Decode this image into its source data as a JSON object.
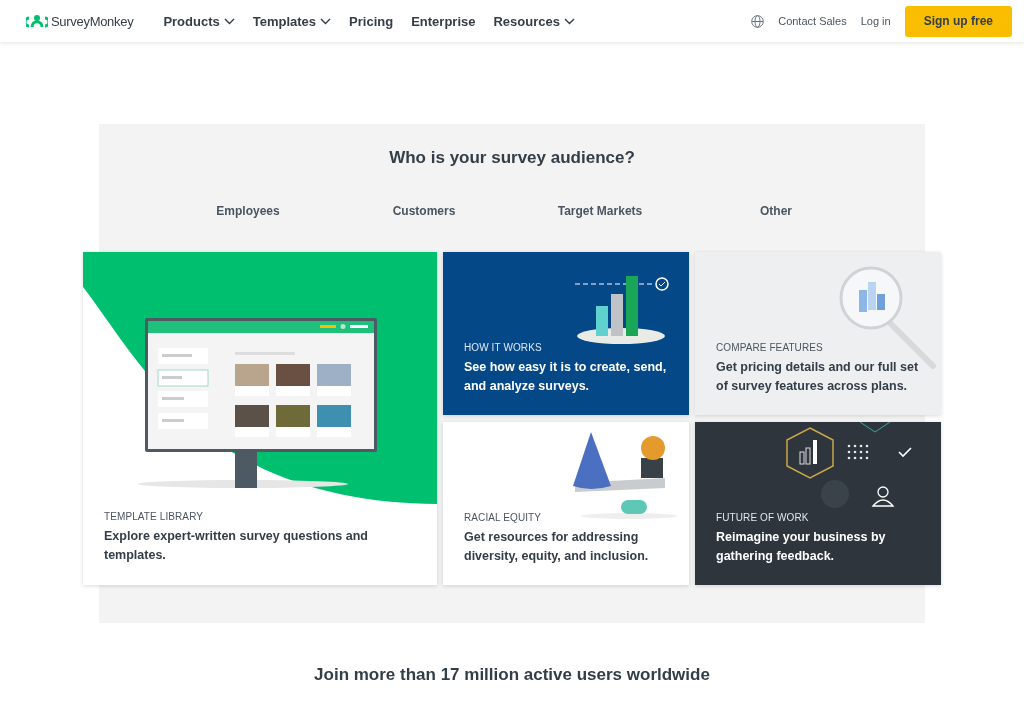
{
  "header": {
    "logo": "SurveyMonkey",
    "nav": [
      {
        "label": "Products",
        "dropdown": true
      },
      {
        "label": "Templates",
        "dropdown": true
      },
      {
        "label": "Pricing",
        "dropdown": false
      },
      {
        "label": "Enterprise",
        "dropdown": false
      },
      {
        "label": "Resources",
        "dropdown": true
      }
    ],
    "contact": "Contact Sales",
    "login": "Log in",
    "signup": "Sign up free"
  },
  "audience": {
    "title": "Who is your survey audience?",
    "tabs": [
      "Employees",
      "Customers",
      "Target Markets",
      "Other"
    ]
  },
  "featured_card": {
    "kind": "template",
    "eyebrow": "TEMPLATE LIBRARY",
    "text": "Explore expert-written survey questions and templates."
  },
  "cards": [
    {
      "kind": "how",
      "eyebrow": "HOW IT WORKS",
      "text": "See how easy it is to create, send, and analyze surveys."
    },
    {
      "kind": "compare",
      "eyebrow": "COMPARE FEATURES",
      "text": "Get pricing details and our full set of survey features across plans."
    },
    {
      "kind": "equity",
      "eyebrow": "RACIAL EQUITY",
      "text": "Get resources for addressing diversity, equity, and inclusion."
    },
    {
      "kind": "future",
      "eyebrow": "FUTURE OF WORK",
      "text": "Reimagine your business by gathering feedback."
    }
  ],
  "footer_heading": "Join more than 17 million active users worldwide"
}
